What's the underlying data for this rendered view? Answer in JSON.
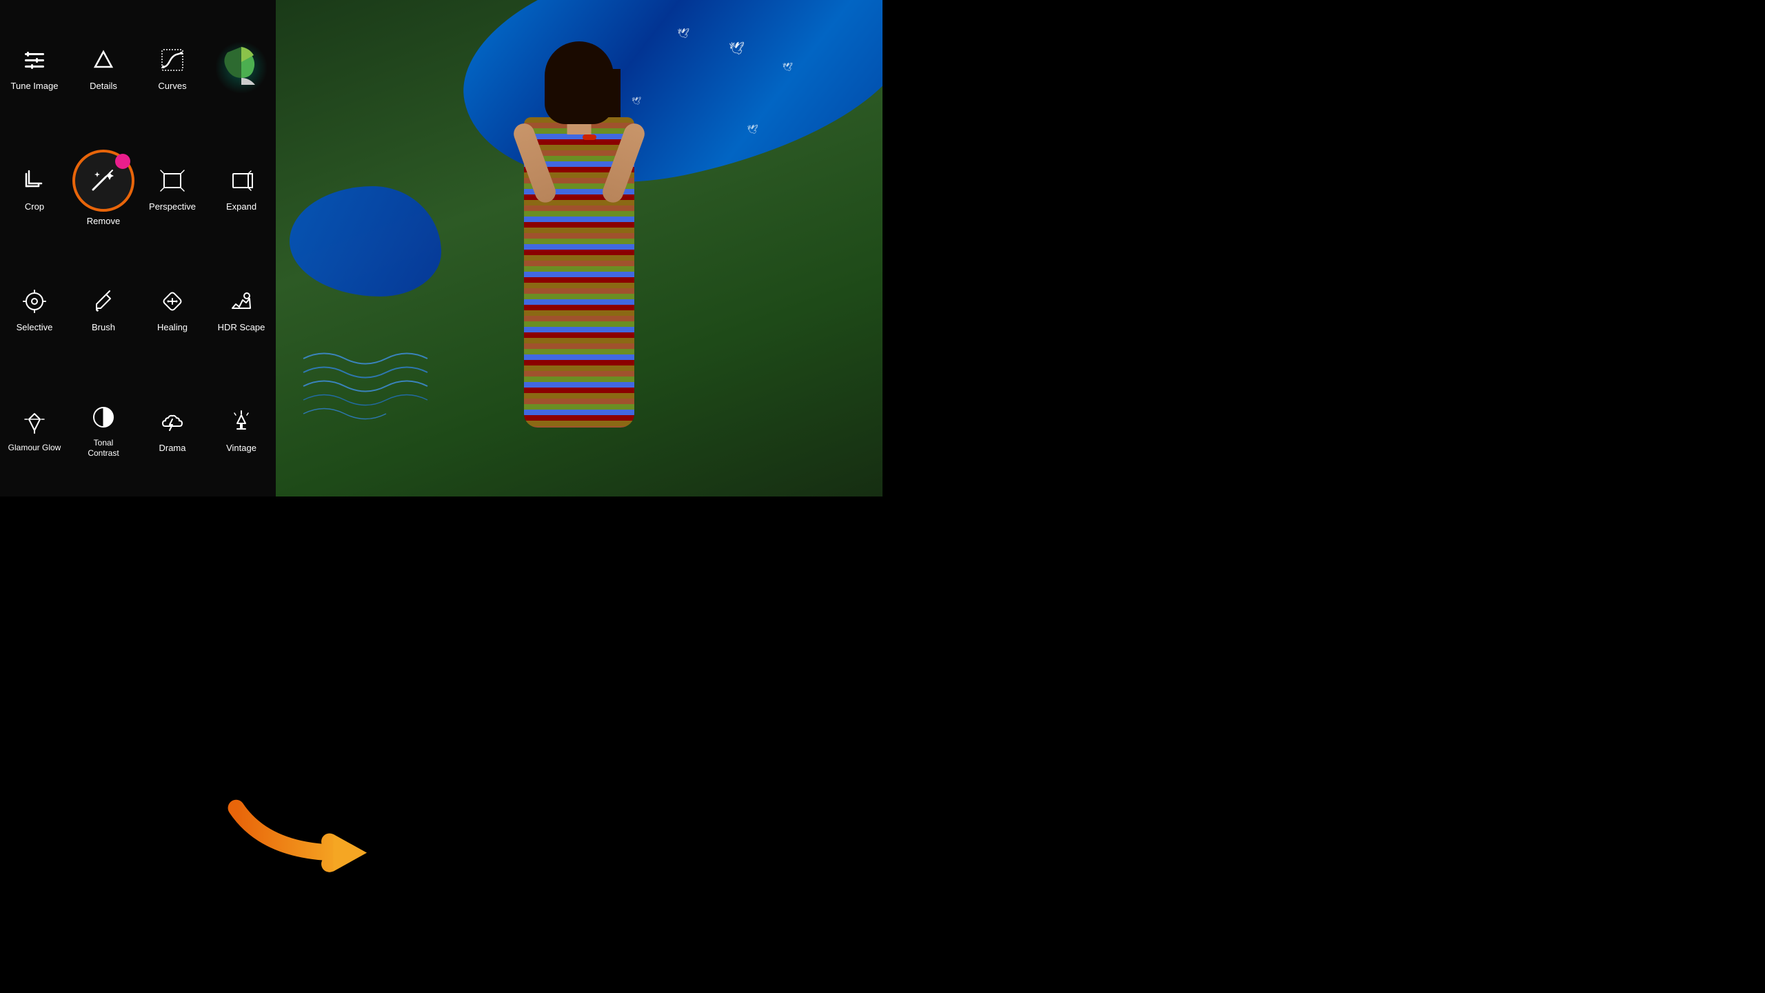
{
  "app": {
    "name": "Snapseed"
  },
  "leftPanel": {
    "tools": [
      {
        "id": "tune-image",
        "label": "Tune Image",
        "icon": "tune"
      },
      {
        "id": "details",
        "label": "Details",
        "icon": "triangle-down"
      },
      {
        "id": "curves",
        "label": "Curves",
        "icon": "curves"
      },
      {
        "id": "logo",
        "label": "",
        "icon": "logo"
      },
      {
        "id": "crop",
        "label": "Crop",
        "icon": "crop"
      },
      {
        "id": "remove",
        "label": "Remove",
        "icon": "remove"
      },
      {
        "id": "perspective",
        "label": "Perspective",
        "icon": "perspective"
      },
      {
        "id": "expand",
        "label": "Expand",
        "icon": "expand"
      },
      {
        "id": "selective",
        "label": "Selective",
        "icon": "selective"
      },
      {
        "id": "brush",
        "label": "Brush",
        "icon": "brush"
      },
      {
        "id": "healing",
        "label": "Healing",
        "icon": "healing"
      },
      {
        "id": "hdr-scape",
        "label": "HDR Scape",
        "icon": "hdr"
      },
      {
        "id": "glamour-glow",
        "label": "Glamour Glow",
        "icon": "glamour"
      },
      {
        "id": "tonal-contrast",
        "label": "Tonal Contrast",
        "icon": "tonal"
      },
      {
        "id": "drama",
        "label": "Drama",
        "icon": "drama"
      },
      {
        "id": "vintage",
        "label": "Vintage",
        "icon": "vintage"
      }
    ]
  },
  "colors": {
    "accent": "#e8650a",
    "pink": "#e91e8c",
    "blue": "#0066cc",
    "bg": "#0a0a0a",
    "text": "#ffffff"
  }
}
